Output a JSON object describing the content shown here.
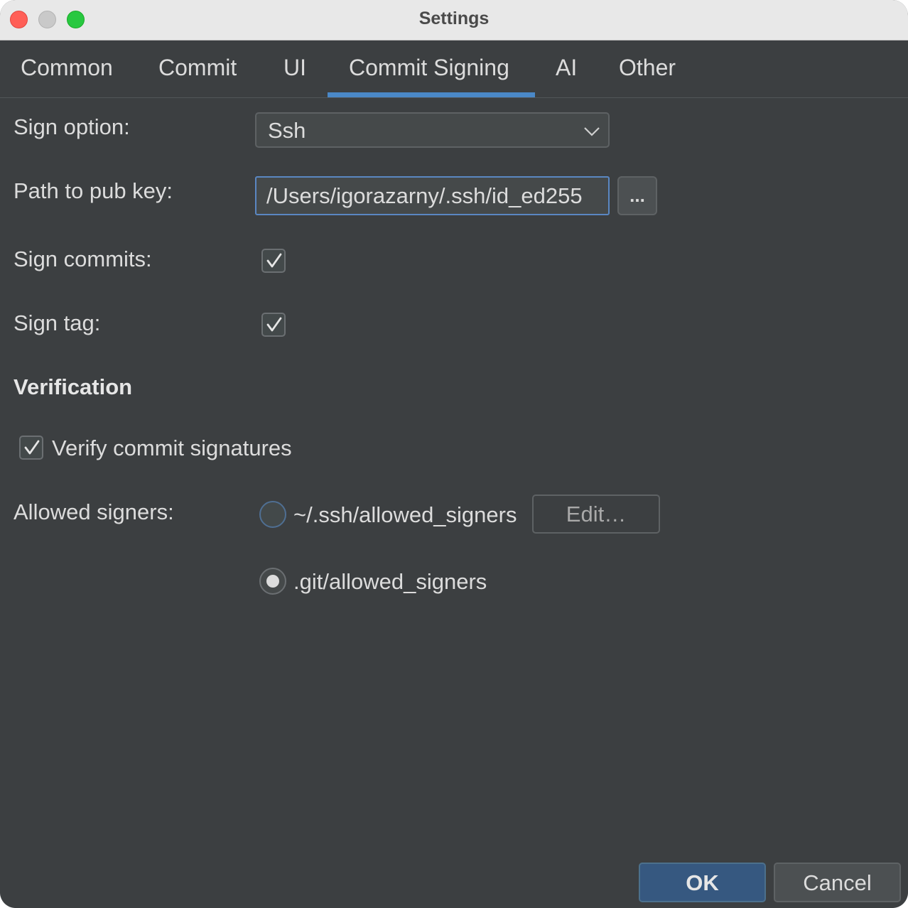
{
  "window": {
    "title": "Settings"
  },
  "tabs": [
    {
      "label": "Common"
    },
    {
      "label": "Commit"
    },
    {
      "label": "UI"
    },
    {
      "label": "Commit Signing",
      "selected": true
    },
    {
      "label": "AI"
    },
    {
      "label": "Other"
    }
  ],
  "form": {
    "sign_option_label": "Sign option:",
    "sign_option_value": "Ssh",
    "pub_key_label": "Path to pub key:",
    "pub_key_value": "/Users/igorazarny/.ssh/id_ed255",
    "browse_label": "...",
    "sign_commits_label": "Sign commits:",
    "sign_commits_checked": true,
    "sign_tag_label": "Sign tag:",
    "sign_tag_checked": true
  },
  "verification": {
    "heading": "Verification",
    "verify_label": "Verify commit signatures",
    "verify_checked": true,
    "allowed_signers_label": "Allowed signers:",
    "options": [
      {
        "label": "~/.ssh/allowed_signers",
        "selected": false
      },
      {
        "label": ".git/allowed_signers",
        "selected": true
      }
    ],
    "edit_label": "Edit…"
  },
  "buttons": {
    "ok": "OK",
    "cancel": "Cancel"
  },
  "colors": {
    "background": "#3c3f41",
    "accent": "#4a88c7",
    "ok_button": "#365880"
  }
}
